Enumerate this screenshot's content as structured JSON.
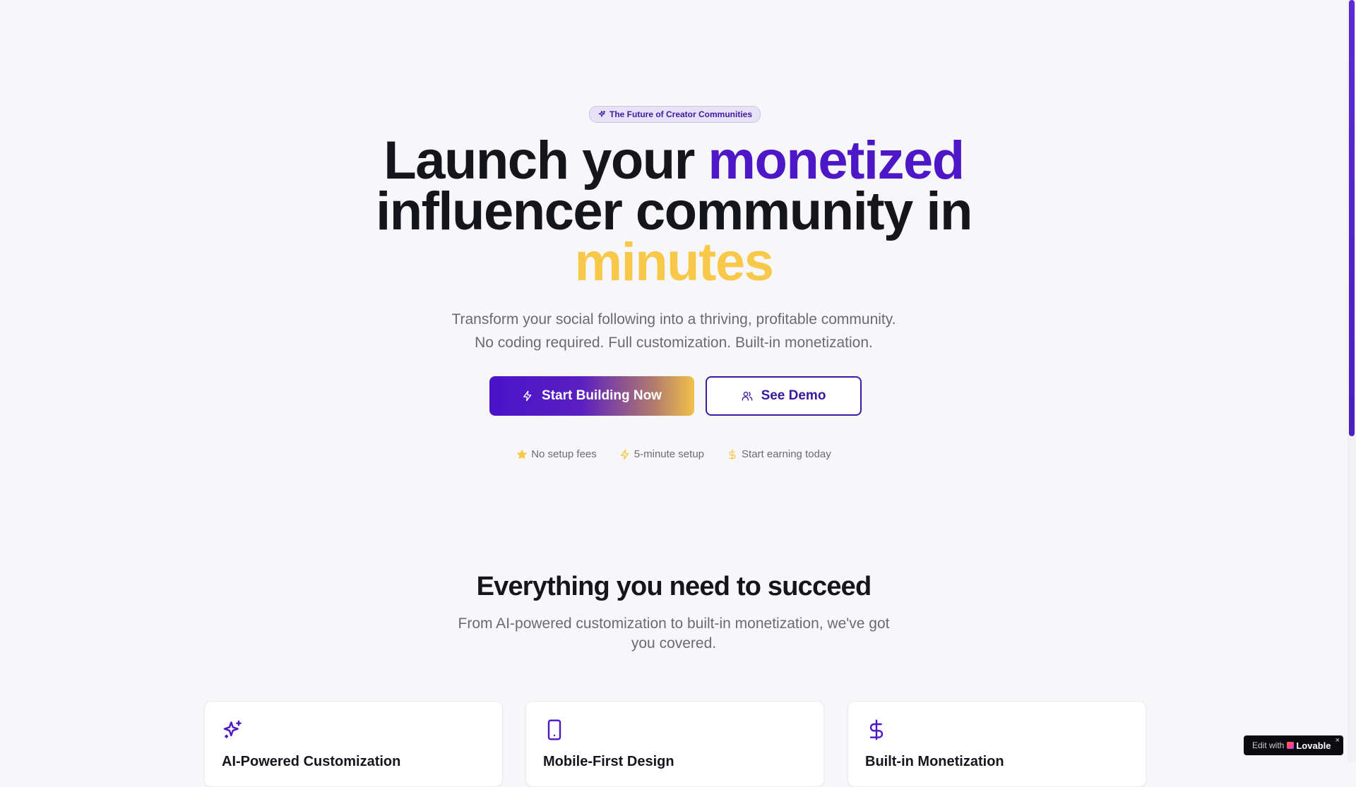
{
  "badge": {
    "icon": "sparkles-icon",
    "label": "The Future of Creator Communities"
  },
  "hero": {
    "line1_plain": "Launch your ",
    "line1_accent": "monetized",
    "line2": "influencer community in",
    "line3_accent": "minutes",
    "subtitle_line1": "Transform your social following into a thriving, profitable community.",
    "subtitle_line2": "No coding required. Full customization. Built-in monetization."
  },
  "buttons": {
    "primary": {
      "icon": "zap-icon",
      "label": "Start Building Now"
    },
    "secondary": {
      "icon": "users-icon",
      "label": "See Demo"
    }
  },
  "perks": [
    {
      "icon": "star-icon",
      "label": "No setup fees"
    },
    {
      "icon": "zap-icon",
      "label": "5-minute setup"
    },
    {
      "icon": "dollar-icon",
      "label": "Start earning today"
    }
  ],
  "features_section": {
    "title": "Everything you need to succeed",
    "subtitle": "From AI-powered customization to built-in monetization, we've got you covered."
  },
  "feature_cards": [
    {
      "icon": "sparkles-icon",
      "title": "AI-Powered Customization"
    },
    {
      "icon": "smartphone-icon",
      "title": "Mobile-First Design"
    },
    {
      "icon": "dollar-icon",
      "title": "Built-in Monetization"
    }
  ],
  "lovable_badge": {
    "prefix": "Edit with",
    "brand": "Lovable",
    "close": "×"
  },
  "colors": {
    "accent_purple": "#4d17c7",
    "accent_yellow": "#f7c84a",
    "background": "#f7f7f9",
    "text_dark": "#15151c",
    "text_muted": "#6a6a76"
  }
}
